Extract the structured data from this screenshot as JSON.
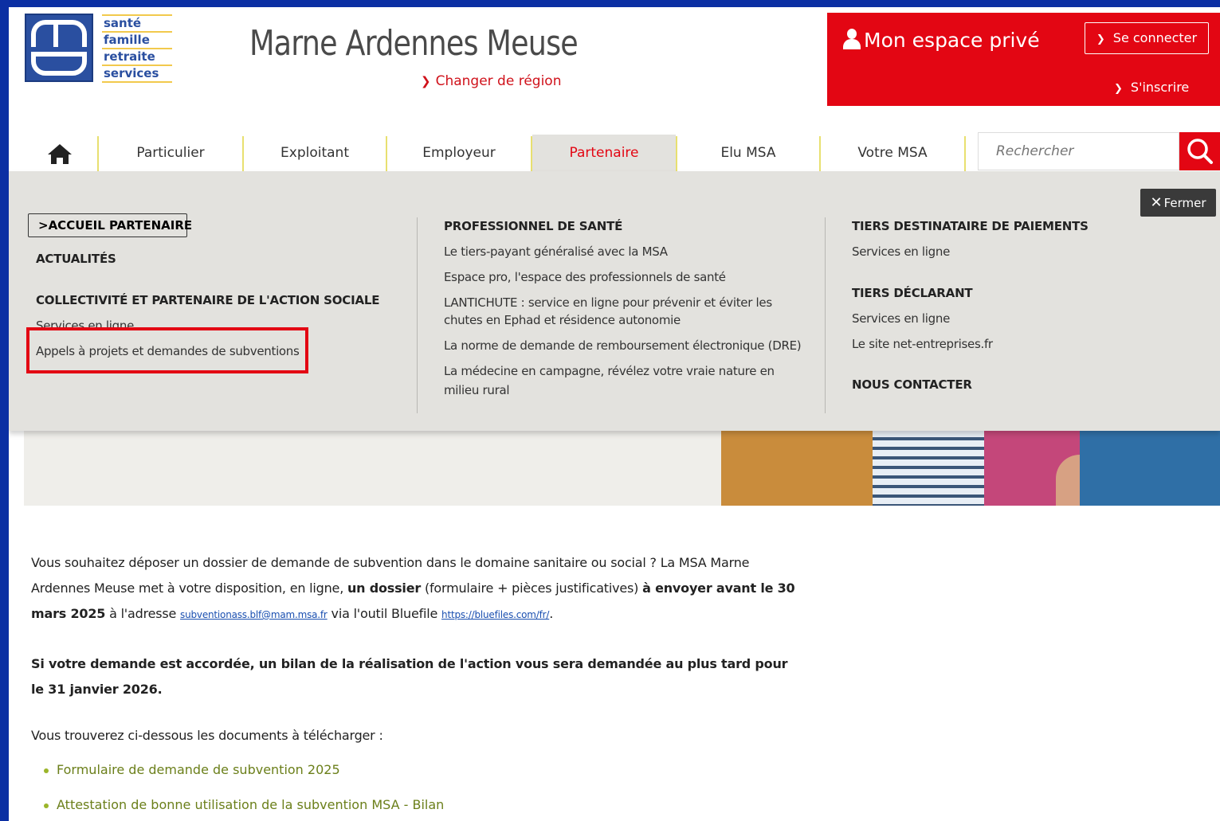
{
  "colors": {
    "frame_blue": "#0b2fa3",
    "msa_red": "#e30613",
    "menu_grey": "#e3e2de",
    "link_green": "#6b7f1a"
  },
  "header": {
    "logo_words": [
      "santé",
      "famille",
      "retraite",
      "services"
    ],
    "region_title": "Marne Ardennes Meuse",
    "change_region": "Changer de région",
    "espace_title": "Mon espace privé",
    "connect_label": "Se connecter",
    "signup_label": "S'inscrire",
    "icons": {
      "user": "user-icon",
      "chevron": "chevron-right-icon"
    }
  },
  "nav": {
    "home_icon": "home-icon",
    "items": [
      {
        "label": "Particulier"
      },
      {
        "label": "Exploitant"
      },
      {
        "label": "Employeur"
      },
      {
        "label": "Partenaire",
        "active": true
      },
      {
        "label": "Elu MSA"
      },
      {
        "label": "Votre MSA"
      }
    ],
    "search_placeholder": "Rechercher",
    "search_icon": "search-icon"
  },
  "mega_menu": {
    "close_label": "Fermer",
    "col1": {
      "accueil": "ACCUEIL PARTENAIRE",
      "actualites": "ACTUALITÉS",
      "collectivite": "COLLECTIVITÉ ET PARTENAIRE DE L'ACTION SOCIALE",
      "services": "Services en ligne",
      "appels": "Appels à projets et demandes de subventions"
    },
    "col2": {
      "heading": "PROFESSIONNEL DE SANTÉ",
      "links": [
        "Le tiers-payant généralisé avec la MSA",
        "Espace pro, l'espace des professionnels de santé",
        "LANTICHUTE : service en ligne pour prévenir et éviter les",
        "chutes en Ephad et résidence autonomie",
        "La norme de demande de remboursement électronique (DRE)",
        "La médecine en campagne, révélez votre vraie nature en",
        "milieu rural"
      ]
    },
    "col3": {
      "tiers_dest": "TIERS DESTINATAIRE DE PAIEMENTS",
      "tiers_dest_link": "Services en ligne",
      "tiers_decl": "TIERS DÉCLARANT",
      "tiers_decl_link1": "Services en ligne",
      "tiers_decl_link2": "Le site net-entreprises.fr",
      "contact": "NOUS CONTACTER"
    }
  },
  "content": {
    "p1_a": "Vous souhaitez déposer un dossier de demande de subvention dans le domaine sanitaire ou social ? La MSA Marne Ardennes Meuse met à votre disposition, en ligne, ",
    "p1_b": "un dossier",
    "p1_c": " (formulaire + pièces justificatives) ",
    "p1_d": "à envoyer avant le 30 mars 2025",
    "p1_e": " à l'adresse ",
    "email": "subventionass.blf@mam.msa.fr",
    "p1_f": " via l'outil Bluefile  ",
    "url": "https://bluefiles.com/fr/",
    "p1_g": ".",
    "p2": "Si votre demande est accordée, un bilan de la réalisation de l'action vous sera demandée au plus tard pour le 31 janvier 2026.",
    "p3": "Vous trouverez ci-dessous les documents à télécharger :",
    "documents": [
      "Formulaire de demande de subvention 2025",
      "Attestation de bonne utilisation de la subvention MSA - Bilan"
    ]
  }
}
